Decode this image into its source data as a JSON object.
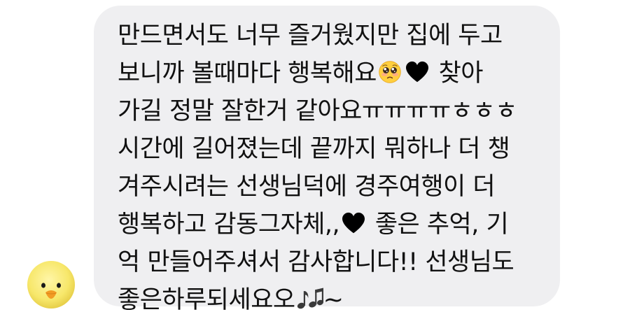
{
  "message": {
    "line1": "만드면서도 너무 즐거웠지만 집에 두고",
    "line2_a": "보니까 볼때마다 행복해요",
    "line2_b": " 찾아",
    "line3": "가길 정말 잘한거 같아요ㅠㅠㅠㅠㅎㅎㅎ",
    "line4": "시간에 길어졌는데 끝까지 뭐하나 더 챙",
    "line5": "겨주시려는 선생님덕에 경주여행이 더",
    "line6_a": "행복하고 감동그자체,,",
    "line6_b": " 좋은 추억, 기",
    "line7": "억 만들어주셔서 감사합니다!! 선생님도",
    "line8_a": "좋은하루되세요오",
    "line8_b": "~"
  },
  "icons": {
    "pleading_face": "pleading-face-emoji",
    "black_heart": "black-heart-emoji",
    "music_notes": "musical-notes-emoji",
    "avatar": "yellow-chick-avatar"
  },
  "colors": {
    "bubble_bg": "#efeff1",
    "text": "#111111",
    "avatar": "#f7e76a"
  }
}
